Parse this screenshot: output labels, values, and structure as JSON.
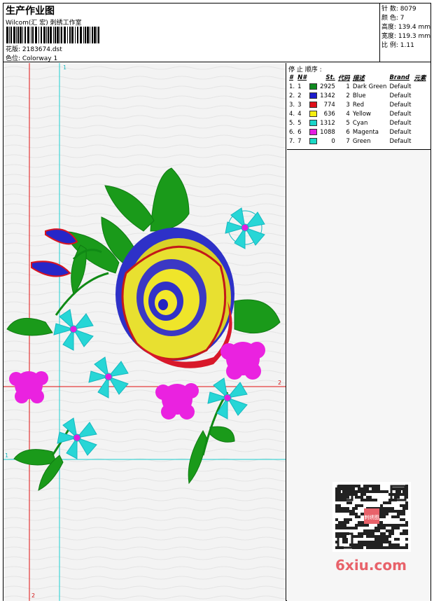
{
  "header": {
    "title": "生产作业图",
    "subtitle": "Wilcom(汇 宏) 刺绣工作室",
    "design_label": "花版: 2183674.dst",
    "colorway_label": "色位:  Colorway 1"
  },
  "specs": {
    "stitches": "针 数: 8079",
    "colors": "颜 色: 7",
    "height": "高度: 139.4 mm",
    "width": "宽度: 119.3 mm",
    "scale": "比 例: 1.11"
  },
  "stop_sequence": {
    "title": "停 止 顺序 :",
    "columns": [
      "#",
      "N#",
      "St.",
      "代码",
      "描述",
      "Brand",
      "元素"
    ],
    "rows": [
      {
        "idx": "1.",
        "n": "1",
        "color": "#0f8a1f",
        "st": "2925",
        "code": "1",
        "desc": "Dark Green",
        "brand": "Default"
      },
      {
        "idx": "2.",
        "n": "2",
        "color": "#1c1ccc",
        "st": "1342",
        "code": "2",
        "desc": "Blue",
        "brand": "Default"
      },
      {
        "idx": "3.",
        "n": "3",
        "color": "#e0101a",
        "st": "774",
        "code": "3",
        "desc": "Red",
        "brand": "Default"
      },
      {
        "idx": "4.",
        "n": "4",
        "color": "#f5ee10",
        "st": "636",
        "code": "4",
        "desc": "Yellow",
        "brand": "Default"
      },
      {
        "idx": "5.",
        "n": "5",
        "color": "#19d4c8",
        "st": "1312",
        "code": "5",
        "desc": "Cyan",
        "brand": "Default"
      },
      {
        "idx": "6.",
        "n": "6",
        "color": "#e51ce0",
        "st": "1088",
        "code": "6",
        "desc": "Magenta",
        "brand": "Default"
      },
      {
        "idx": "7.",
        "n": "7",
        "color": "#1ad9c5",
        "st": "0",
        "code": "7",
        "desc": "Green",
        "brand": "Default"
      }
    ]
  },
  "guides": {
    "v1_label": "1",
    "v2_label": "2",
    "h1_label": "1",
    "h2_label": "2"
  },
  "watermark": {
    "text": "6xiu.com",
    "qr_center": "刺绣图"
  }
}
